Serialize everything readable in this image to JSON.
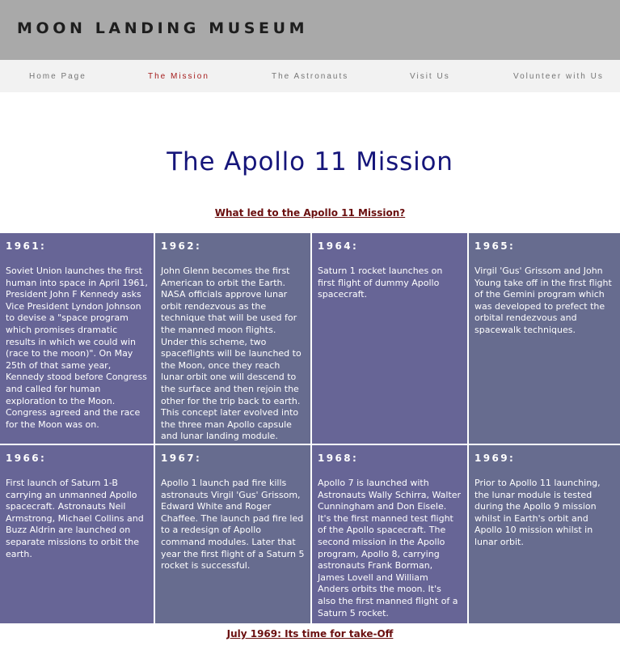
{
  "site": {
    "title": "MOON LANDING MUSEUM"
  },
  "nav": {
    "items": [
      {
        "label": "Home Page",
        "active": false
      },
      {
        "label": "The Mission",
        "active": true
      },
      {
        "label": "The Astronauts",
        "active": false
      },
      {
        "label": "Visit Us",
        "active": false
      },
      {
        "label": "Volunteer with Us",
        "active": false
      }
    ]
  },
  "main": {
    "title": "The Apollo 11 Mission",
    "section_link": "What led to the Apollo 11 Mission?",
    "bottom_link": "July 1969: Its time for take-Off"
  },
  "colors": {
    "header_bg": "#a9a9a9",
    "nav_bg": "#f2f2f2",
    "active_nav": "#a51c1c",
    "title": "#15157a",
    "card_purple": "#676596",
    "card_slate": "#676c8f"
  },
  "timeline": [
    {
      "year": "1961:",
      "text": "Soviet Union launches the first human into space in April 1961, President John F Kennedy asks Vice President Lyndon Johnson to devise a \"space program which promises dramatic results in which we could win (race to the moon)\". On May 25th of that same year, Kennedy stood before Congress and called for human exploration to the Moon. Congress agreed and the race for the Moon was on."
    },
    {
      "year": "1962:",
      "text": "John Glenn becomes the first American to orbit the Earth. NASA officials approve lunar orbit rendezvous as the technique that will be used for the manned moon flights. Under this scheme, two spaceflights will be launched to the Moon, once they reach lunar orbit one will descend to the surface and then rejoin the other for the trip back to earth. This concept later evolved into the three man Apollo capsule and lunar landing module."
    },
    {
      "year": "1964:",
      "text": "Saturn 1 rocket launches on first flight of dummy Apollo spacecraft."
    },
    {
      "year": "1965:",
      "text": "Virgil 'Gus' Grissom and John Young take off in the first flight of the Gemini program which was developed to prefect the orbital rendezvous and spacewalk techniques."
    },
    {
      "year": "1966:",
      "text": "First launch of Saturn 1-B carrying an unmanned Apollo spacecraft. Astronauts Neil Armstrong, Michael Collins and Buzz Aldrin are launched on separate missions to orbit the earth."
    },
    {
      "year": "1967:",
      "text": "Apollo 1 launch pad fire kills astronauts Virgil 'Gus' Grissom, Edward White and Roger Chaffee. The launch pad fire led to a redesign of Apollo command modules. Later that year the first flight of a Saturn 5 rocket is successful."
    },
    {
      "year": "1968:",
      "text": "Apollo 7 is launched with Astronauts Wally Schirra, Walter Cunningham and Don Eisele. It's the first manned test flight of the Apollo spacecraft. The second mission in the Apollo program, Apollo 8, carrying astronauts Frank Borman, James Lovell and William Anders orbits the moon. It's also the first manned flight of a Saturn 5 rocket."
    },
    {
      "year": "1969:",
      "text": "Prior to Apollo 11 launching, the lunar module is tested during the Apollo 9 mission whilst in Earth's orbit and Apollo 10 mission whilst in lunar orbit."
    }
  ]
}
